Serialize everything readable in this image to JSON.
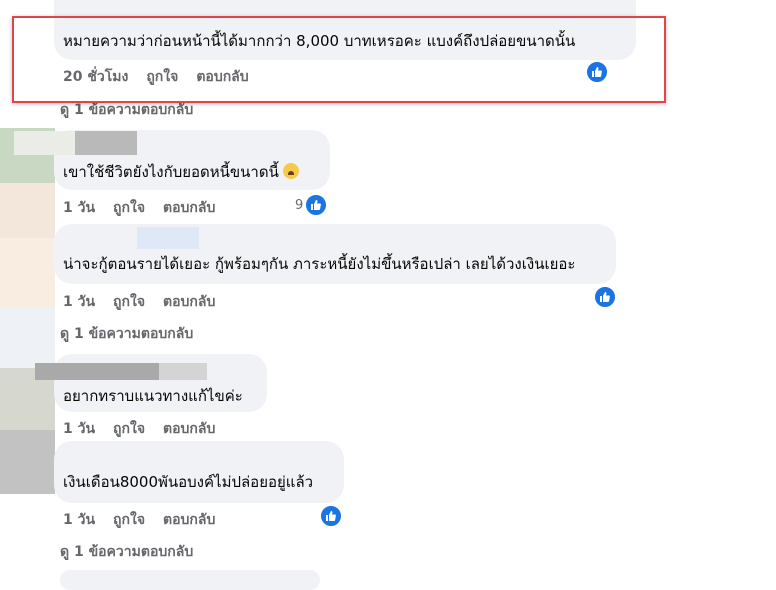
{
  "comments": [
    {
      "text": "หมายความว่าก่อนหน้านี้ได้มากกว่า 8,000 บาทเหรอคะ แบงค์ถึงปล่อยขนาดนั้น",
      "time": "20 ชั่วโมง",
      "like_label": "ถูกใจ",
      "reply_label": "ตอบกลับ",
      "reactions": "",
      "replies_link": "ดู 1 ข้อความตอบกลับ"
    },
    {
      "text": "เขาใช้ชีวิตยังไงกับยอดหนี้ขนาดนี้",
      "time": "1 วัน",
      "like_label": "ถูกใจ",
      "reply_label": "ตอบกลับ",
      "reactions": "9",
      "replies_link": ""
    },
    {
      "text": "น่าจะกู้ตอนรายได้เยอะ กู้พร้อมๆกัน ภาระหนี้ยังไม่ขึ้นหรือเปล่า เลยได้วงเงินเยอะ",
      "time": "1 วัน",
      "like_label": "ถูกใจ",
      "reply_label": "ตอบกลับ",
      "reactions": "",
      "replies_link": "ดู 1 ข้อความตอบกลับ"
    },
    {
      "text": "อยากทราบแนวทางแก้ไขค่ะ",
      "time": "1 วัน",
      "like_label": "ถูกใจ",
      "reply_label": "ตอบกลับ",
      "reactions": "",
      "replies_link": ""
    },
    {
      "text": "เงินเดือน8000พันอบงค์ไม่ปล่อยอยู่แล้ว",
      "time": "1 วัน",
      "like_label": "ถูกใจ",
      "reply_label": "ตอบกลับ",
      "reactions": "",
      "replies_link": "ดู 1 ข้อความตอบกลับ"
    }
  ],
  "icons": {
    "like": "thumbs-up-icon",
    "emoji": "crying-face-emoji"
  },
  "colors": {
    "like_badge": "#1b74e4",
    "bubble": "#f0f2f5",
    "highlight": "#e0454a",
    "meta": "#65676b"
  }
}
